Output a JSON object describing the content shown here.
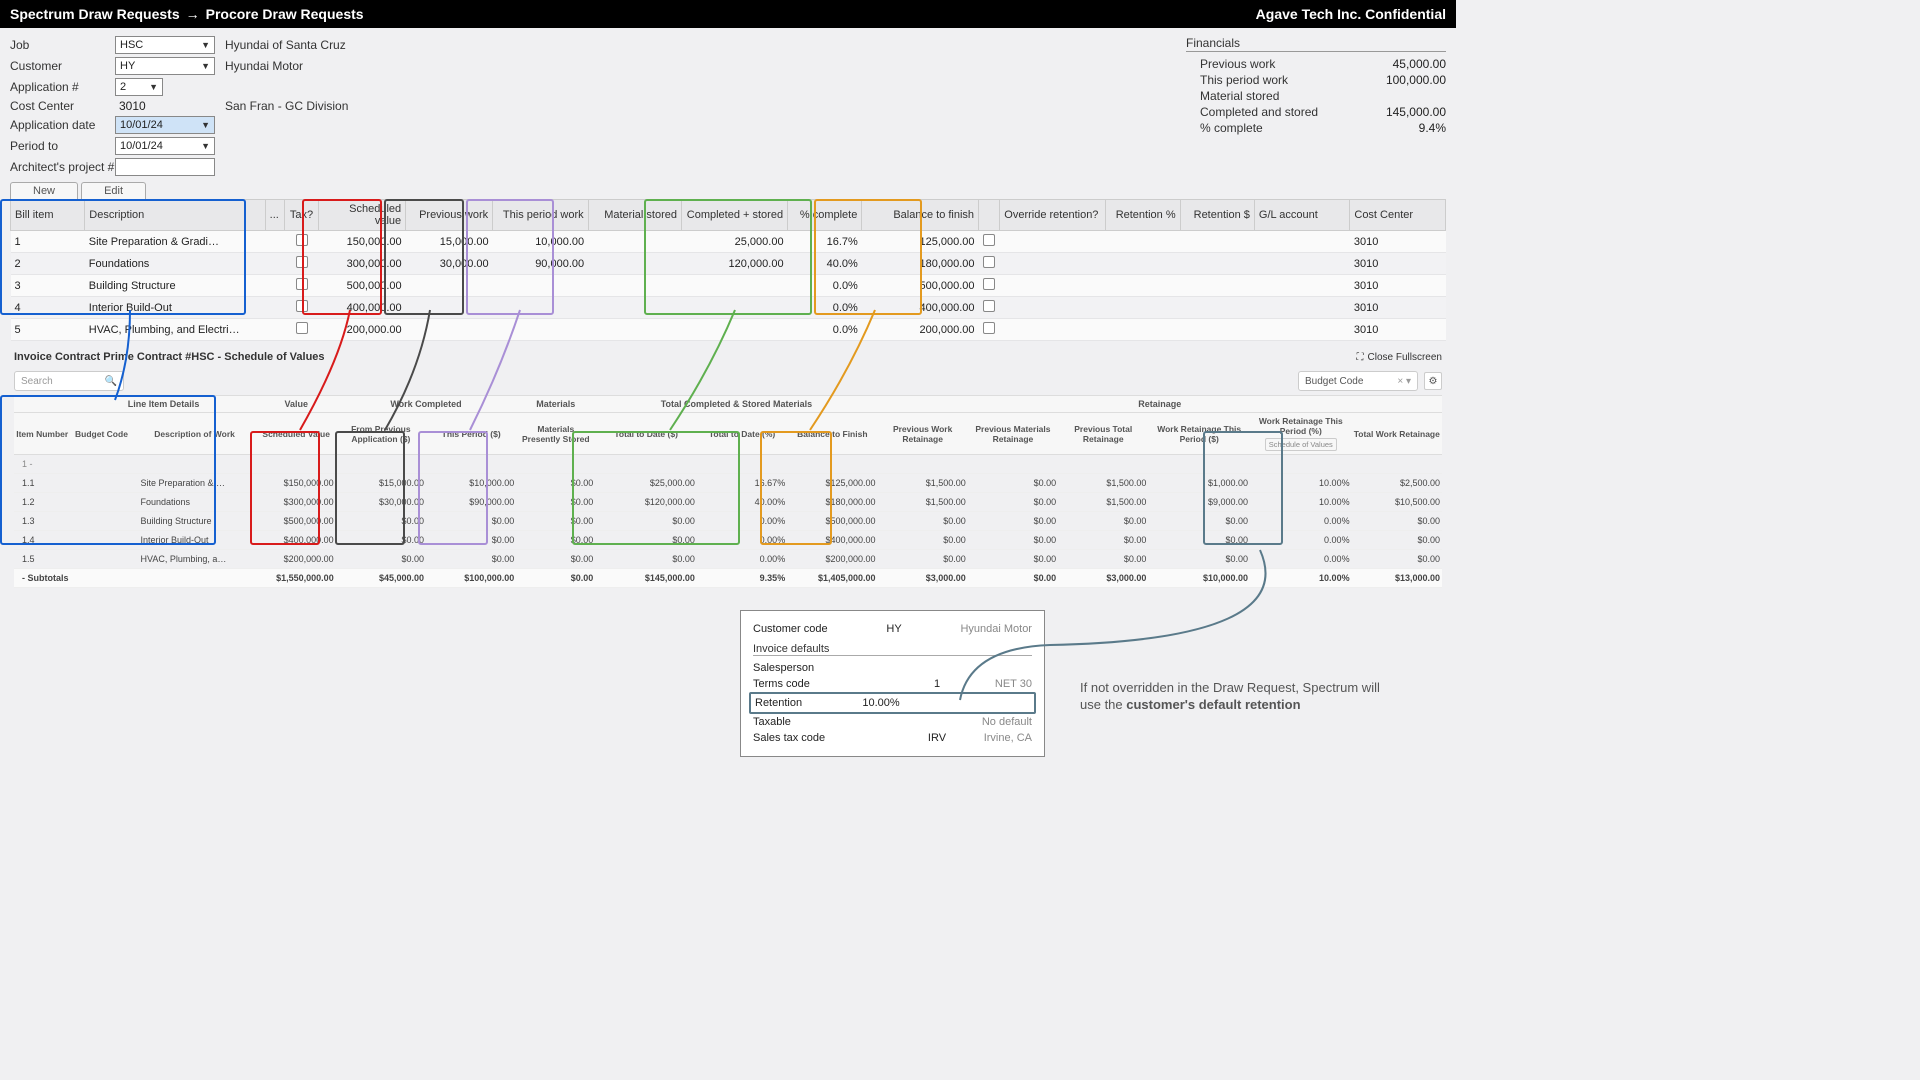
{
  "header": {
    "title_left": "Spectrum Draw Requests",
    "title_right": "Procore Draw Requests",
    "confidential": "Agave Tech Inc. Confidential"
  },
  "form": {
    "labels": {
      "job": "Job",
      "customer": "Customer",
      "app_no": "Application #",
      "cost_center": "Cost Center",
      "app_date": "Application date",
      "period_to": "Period to",
      "arch_proj": "Architect's project #"
    },
    "values": {
      "job": "HSC",
      "customer": "HY",
      "app_no": "2",
      "cost_center": "3010",
      "app_date": "10/01/24",
      "period_to": "10/01/24",
      "arch_proj": ""
    },
    "descs": {
      "job": "Hyundai of Santa Cruz",
      "customer": "Hyundai Motor",
      "cost_center": "San Fran - GC Division"
    }
  },
  "financials": {
    "title": "Financials",
    "rows": [
      {
        "label": "Previous work",
        "value": "45,000.00"
      },
      {
        "label": "This period work",
        "value": "100,000.00"
      },
      {
        "label": "Material stored",
        "value": ""
      },
      {
        "label": "Completed and stored",
        "value": "145,000.00"
      },
      {
        "label": "% complete",
        "value": "9.4%"
      }
    ]
  },
  "buttons": {
    "new": "New",
    "edit": "Edit"
  },
  "spec": {
    "headers": [
      "Bill item",
      "Description",
      "...",
      "Tax?",
      "Scheduled value",
      "Previous work",
      "This period work",
      "Material stored",
      "Completed + stored",
      "% complete",
      "Balance to finish",
      "",
      "Override retention?",
      "Retention %",
      "Retention $",
      "G/L account",
      "Cost Center"
    ],
    "rows": [
      {
        "bill": "1",
        "desc": "Site Preparation & Gradi…",
        "sched": "150,000.00",
        "prev": "15,000.00",
        "this": "10,000.00",
        "mat": "",
        "comp": "25,000.00",
        "pct": "16.7%",
        "bal": "125,000.00",
        "cc": "3010"
      },
      {
        "bill": "2",
        "desc": "Foundations",
        "sched": "300,000.00",
        "prev": "30,000.00",
        "this": "90,000.00",
        "mat": "",
        "comp": "120,000.00",
        "pct": "40.0%",
        "bal": "180,000.00",
        "cc": "3010"
      },
      {
        "bill": "3",
        "desc": "Building Structure",
        "sched": "500,000.00",
        "prev": "",
        "this": "",
        "mat": "",
        "comp": "",
        "pct": "0.0%",
        "bal": "500,000.00",
        "cc": "3010"
      },
      {
        "bill": "4",
        "desc": "Interior Build-Out",
        "sched": "400,000.00",
        "prev": "",
        "this": "",
        "mat": "",
        "comp": "",
        "pct": "0.0%",
        "bal": "400,000.00",
        "cc": "3010"
      },
      {
        "bill": "5",
        "desc": "HVAC, Plumbing, and Electri…",
        "sched": "200,000.00",
        "prev": "",
        "this": "",
        "mat": "",
        "comp": "",
        "pct": "0.0%",
        "bal": "200,000.00",
        "cc": "3010"
      }
    ]
  },
  "procore": {
    "title": "Invoice Contract Prime Contract #HSC - Schedule of Values",
    "close": "Close Fullscreen",
    "search_ph": "Search",
    "budget_label": "Budget Code",
    "groups": [
      "",
      "Line Item Details",
      "",
      "Value",
      "",
      "Work Completed",
      "",
      "Materials",
      "",
      "Total Completed & Stored Materials",
      "",
      "Retainage"
    ],
    "sub": [
      "Item Number",
      "Budget Code",
      "Description of Work",
      "Scheduled Value",
      "From Previous Application ($)",
      "This Period ($)",
      "Materials Presently Stored",
      "Total to Date ($)",
      "Total to Date (%)",
      "Balance to Finish",
      "Previous Work Retainage",
      "Previous Materials Retainage",
      "Previous Total Retainage",
      "Work Retainage This Period ($)",
      "Work Retainage This Period (%)",
      "Total Work Retainage"
    ],
    "badge": "Schedule of Values",
    "grouprow": "1 -",
    "rows": [
      {
        "n": "1.1",
        "d": "Site Preparation & …",
        "sv": "$150,000.00",
        "fp": "$15,000.00",
        "tp": "$10,000.00",
        "mp": "$0.00",
        "td": "$25,000.00",
        "tp2": "16.67%",
        "bf": "$125,000.00",
        "pwr": "$1,500.00",
        "pmr": "$0.00",
        "ptr": "$1,500.00",
        "wrp": "$1,000.00",
        "wrpp": "10.00%",
        "twr": "$2,500.00"
      },
      {
        "n": "1.2",
        "d": "Foundations",
        "sv": "$300,000.00",
        "fp": "$30,000.00",
        "tp": "$90,000.00",
        "mp": "$0.00",
        "td": "$120,000.00",
        "tp2": "40.00%",
        "bf": "$180,000.00",
        "pwr": "$1,500.00",
        "pmr": "$0.00",
        "ptr": "$1,500.00",
        "wrp": "$9,000.00",
        "wrpp": "10.00%",
        "twr": "$10,500.00"
      },
      {
        "n": "1.3",
        "d": "Building Structure",
        "sv": "$500,000.00",
        "fp": "$0.00",
        "tp": "$0.00",
        "mp": "$0.00",
        "td": "$0.00",
        "tp2": "0.00%",
        "bf": "$500,000.00",
        "pwr": "$0.00",
        "pmr": "$0.00",
        "ptr": "$0.00",
        "wrp": "$0.00",
        "wrpp": "0.00%",
        "twr": "$0.00"
      },
      {
        "n": "1.4",
        "d": "Interior Build-Out",
        "sv": "$400,000.00",
        "fp": "$0.00",
        "tp": "$0.00",
        "mp": "$0.00",
        "td": "$0.00",
        "tp2": "0.00%",
        "bf": "$400,000.00",
        "pwr": "$0.00",
        "pmr": "$0.00",
        "ptr": "$0.00",
        "wrp": "$0.00",
        "wrpp": "0.00%",
        "twr": "$0.00"
      },
      {
        "n": "1.5",
        "d": "HVAC, Plumbing, a…",
        "sv": "$200,000.00",
        "fp": "$0.00",
        "tp": "$0.00",
        "mp": "$0.00",
        "td": "$0.00",
        "tp2": "0.00%",
        "bf": "$200,000.00",
        "pwr": "$0.00",
        "pmr": "$0.00",
        "ptr": "$0.00",
        "wrp": "$0.00",
        "wrpp": "0.00%",
        "twr": "$0.00"
      }
    ],
    "subtotal": {
      "label": "- Subtotals",
      "sv": "$1,550,000.00",
      "fp": "$45,000.00",
      "tp": "$100,000.00",
      "mp": "$0.00",
      "td": "$145,000.00",
      "tp2": "9.35%",
      "bf": "$1,405,000.00",
      "pwr": "$3,000.00",
      "pmr": "$0.00",
      "ptr": "$3,000.00",
      "wrp": "$10,000.00",
      "wrpp": "10.00%",
      "twr": "$13,000.00"
    }
  },
  "callout": {
    "cust_code_lbl": "Customer code",
    "cust_code": "HY",
    "cust_name": "Hyundai Motor",
    "sec": "Invoice defaults",
    "rows": [
      {
        "l": "Salesperson",
        "v": "",
        "r": ""
      },
      {
        "l": "Terms code",
        "v": "1",
        "r": "NET 30"
      }
    ],
    "ret": {
      "l": "Retention",
      "v": "10.00%"
    },
    "tail": [
      {
        "l": "Taxable",
        "v": "",
        "r": "No default"
      },
      {
        "l": "Sales tax code",
        "v": "IRV",
        "r": "Irvine, CA"
      }
    ]
  },
  "note": {
    "t1": "If not overridden in the Draw Request, Spectrum will use the ",
    "b": "customer's default retention"
  }
}
